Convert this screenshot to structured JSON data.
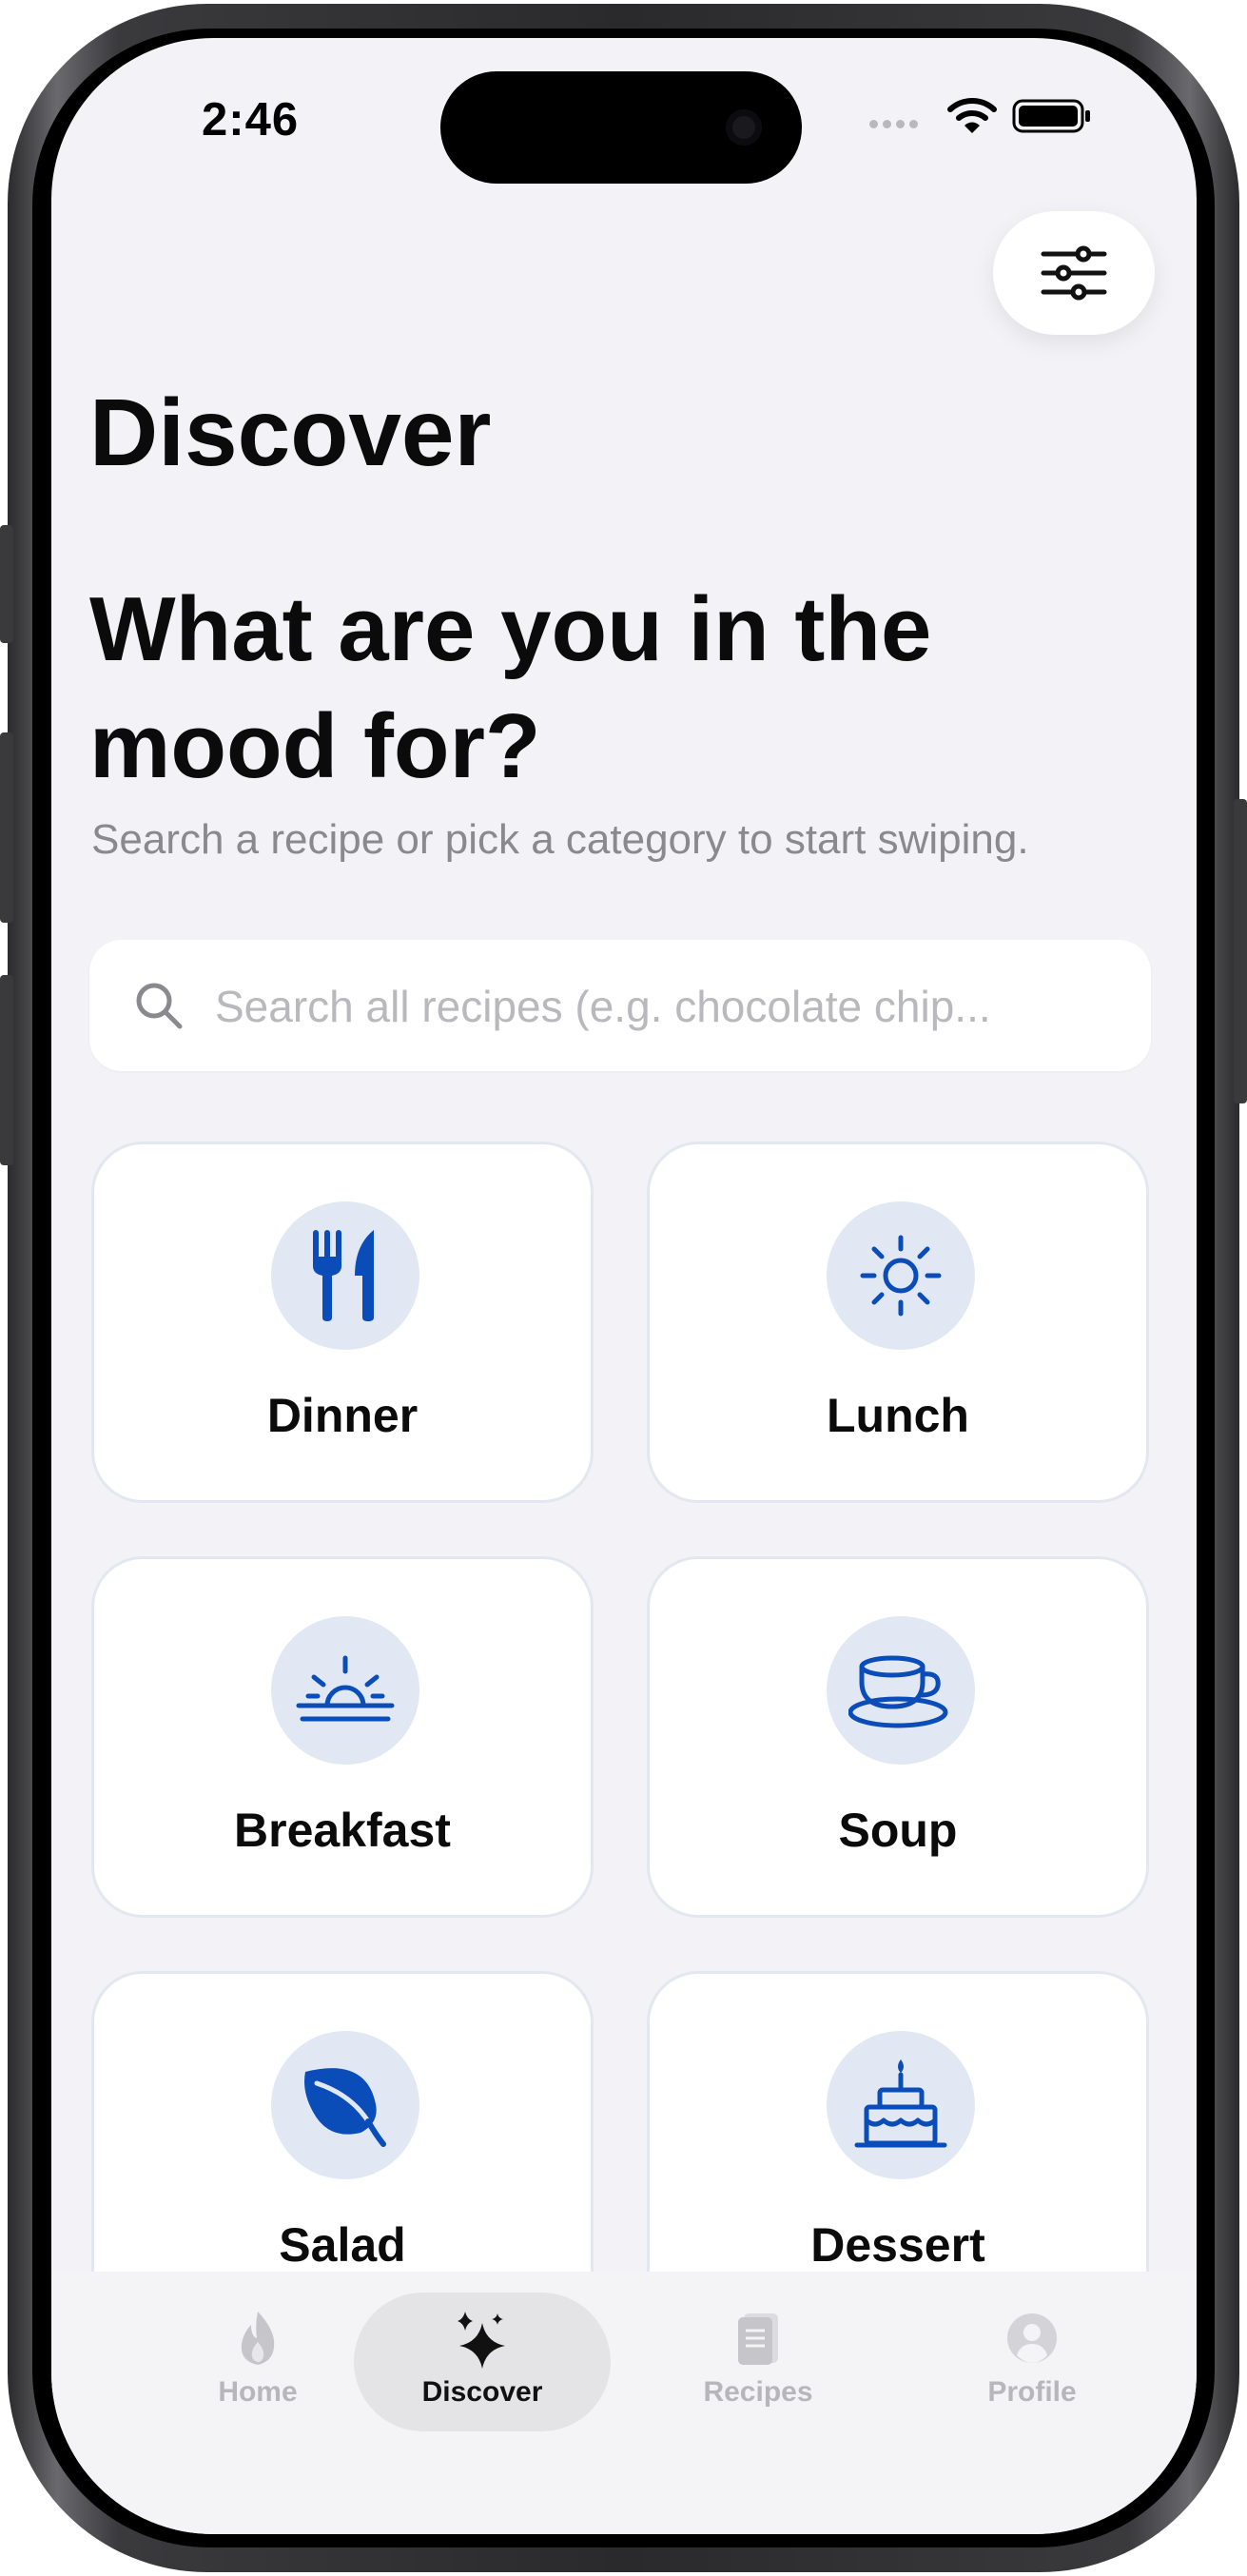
{
  "status_bar": {
    "time": "2:46"
  },
  "header": {
    "title": "Discover"
  },
  "hero": {
    "headline": "What are you in the mood for?",
    "subtext": "Search a recipe or pick a category to start swiping."
  },
  "search": {
    "placeholder": "Search all recipes (e.g. chocolate chip...",
    "value": ""
  },
  "categories": [
    {
      "label": "Dinner",
      "icon": "fork-knife-icon"
    },
    {
      "label": "Lunch",
      "icon": "sun-icon"
    },
    {
      "label": "Breakfast",
      "icon": "sunrise-icon"
    },
    {
      "label": "Soup",
      "icon": "cup-icon"
    },
    {
      "label": "Salad",
      "icon": "leaf-icon"
    },
    {
      "label": "Dessert",
      "icon": "birthday-cake-icon"
    }
  ],
  "tab_bar": {
    "tabs": [
      {
        "label": "Home",
        "icon": "flame-icon",
        "active": false
      },
      {
        "label": "Discover",
        "icon": "sparkles-icon",
        "active": true
      },
      {
        "label": "Recipes",
        "icon": "book-icon",
        "active": false
      },
      {
        "label": "Profile",
        "icon": "person-icon",
        "active": false
      }
    ]
  },
  "colors": {
    "accent": "#0b4db8",
    "icon_circle": "#e1e8f4",
    "background": "#f2f2f7",
    "card": "#ffffff",
    "inactive_tab": "#b7b7bb"
  }
}
